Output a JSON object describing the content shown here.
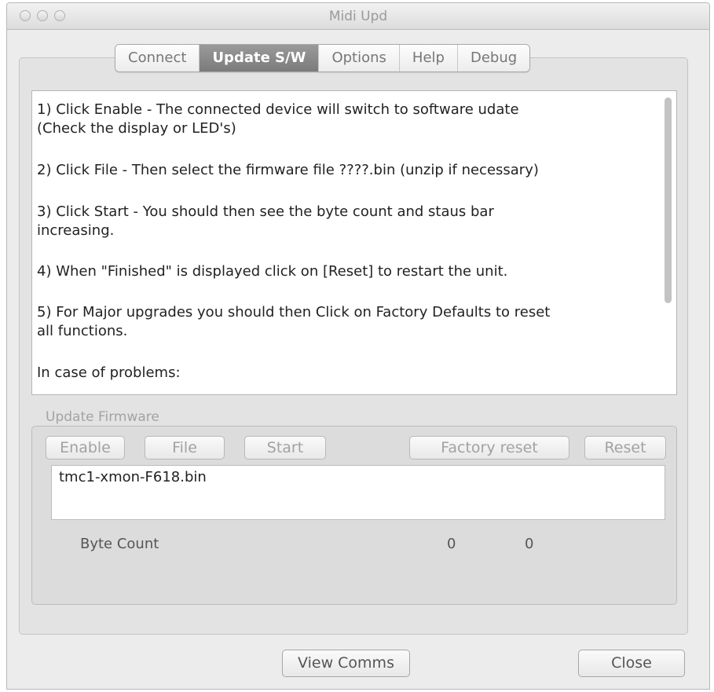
{
  "window": {
    "title": "Midi  Upd"
  },
  "tabs": [
    "Connect",
    "Update S/W",
    "Options",
    "Help",
    "Debug"
  ],
  "selected_tab": "Update S/W",
  "instructions": [
    "1) Click Enable - The connected device will switch to software udate",
    "(Check the display or LED's)",
    "2) Click File - Then select the firmware file ????.bin (unzip if necessary)",
    "3) Click Start - You should then see the byte count and staus bar",
    "increasing.",
    "4) When \"Finished\" is displayed click on [Reset] to restart the unit.",
    "5) For Major upgrades you should then Click on Factory Defaults to reset",
    "all functions.",
    "In case of problems:"
  ],
  "update_firmware": {
    "label": "Update Firmware",
    "buttons": {
      "enable": "Enable",
      "file": "File",
      "start": "Start",
      "factory_reset": "Factory reset",
      "reset": "Reset"
    },
    "file_name": "tmc1-xmon-F618.bin",
    "byte_count_label": "Byte Count",
    "byte_count_values": [
      "0",
      "0"
    ]
  },
  "footer": {
    "view_comms": "View Comms",
    "close": "Close"
  }
}
